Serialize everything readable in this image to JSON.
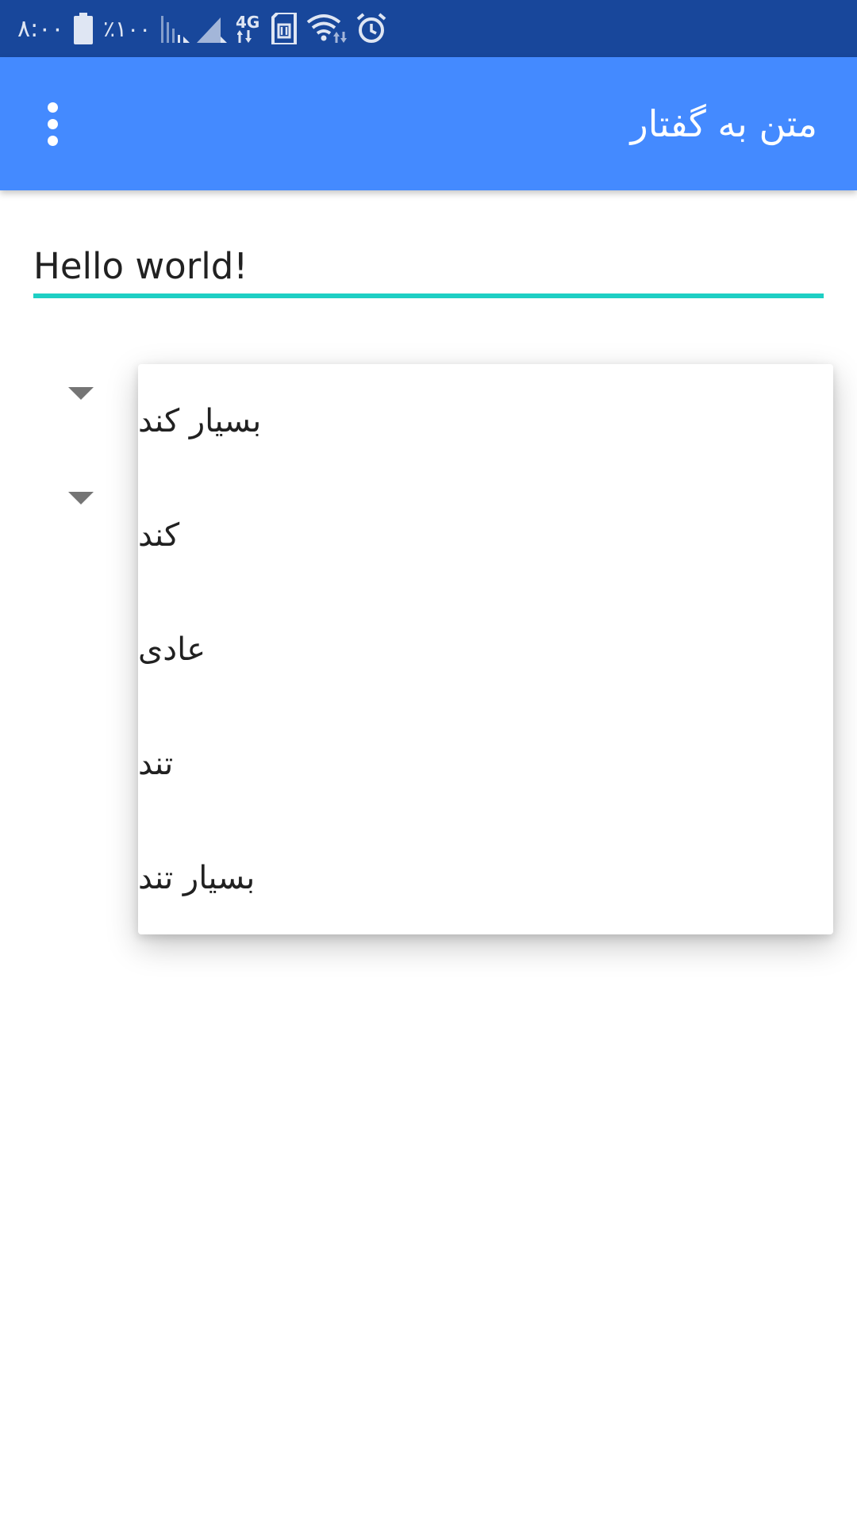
{
  "status_bar": {
    "time": "۸:۰۰",
    "battery_percent": "٪۱۰۰",
    "network_label": "4G",
    "icons": [
      "battery-icon",
      "signal-icon",
      "signal-icon",
      "network-data-icon",
      "sim-icon",
      "wifi-icon",
      "alarm-icon"
    ]
  },
  "app_bar": {
    "title": "متن به گفتار",
    "menu_icon": "overflow-menu-icon",
    "color": "#448aff"
  },
  "input": {
    "value": "Hello world!",
    "underline_color": "#1ecfc4"
  },
  "dropdown": {
    "items": [
      {
        "label": "بسیار کند"
      },
      {
        "label": "کند"
      },
      {
        "label": "عادی"
      },
      {
        "label": "تند"
      },
      {
        "label": "بسیار تند"
      }
    ]
  },
  "colors": {
    "status_bar": "#18479b",
    "app_bar": "#448aff",
    "accent": "#1ecfc4"
  }
}
